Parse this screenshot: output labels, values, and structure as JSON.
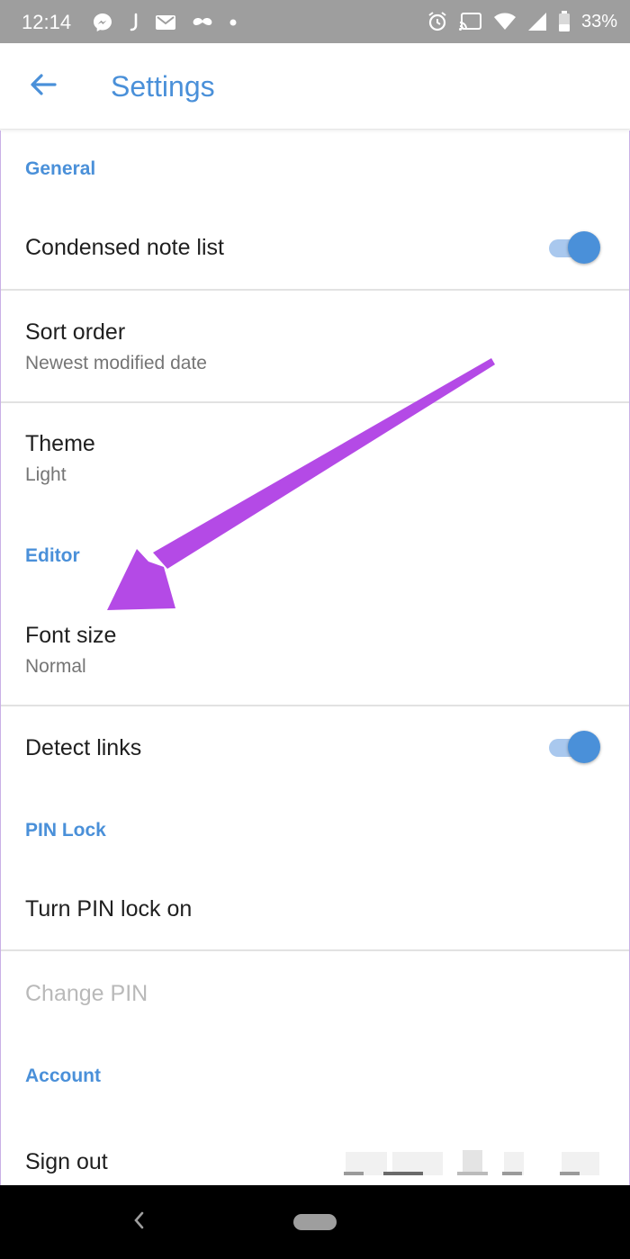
{
  "status_bar": {
    "time": "12:14",
    "battery": "33%",
    "icons": [
      "messenger-icon",
      "j-app-icon",
      "gmail-icon",
      "mustache-icon",
      "dot-icon",
      "alarm-icon",
      "cast-icon",
      "wifi-icon",
      "signal-icon",
      "battery-icon"
    ]
  },
  "app_bar": {
    "title": "Settings",
    "back_icon": "arrow-left-icon"
  },
  "sections": {
    "general": {
      "header": "General",
      "condensed_note_list": {
        "title": "Condensed note list",
        "toggle_on": true
      },
      "sort_order": {
        "title": "Sort order",
        "value": "Newest modified date"
      },
      "theme": {
        "title": "Theme",
        "value": "Light"
      }
    },
    "editor": {
      "header": "Editor",
      "font_size": {
        "title": "Font size",
        "value": "Normal"
      },
      "detect_links": {
        "title": "Detect links",
        "toggle_on": true
      }
    },
    "pin_lock": {
      "header": "PIN Lock",
      "turn_on": {
        "title": "Turn PIN lock on"
      },
      "change_pin": {
        "title": "Change PIN",
        "enabled": false
      }
    },
    "account": {
      "header": "Account",
      "sign_out": {
        "title": "Sign out"
      }
    }
  },
  "colors": {
    "accent": "#4a90d9",
    "status_bar": "#9e9e9e",
    "annotation_arrow": "#b44ae6",
    "nav_bar": "#000000"
  },
  "nav_bar": {
    "back_icon": "nav-back-icon",
    "home_icon": "nav-home-pill-icon"
  }
}
